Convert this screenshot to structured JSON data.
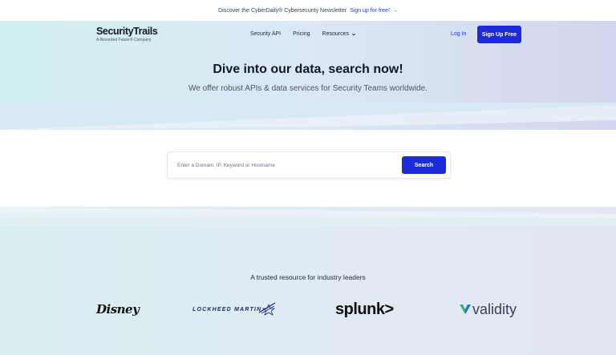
{
  "announcement": {
    "text": "Discover the CyberDaily® Cybersecurity Newsletter",
    "link": "Sign up for free!",
    "arrow": "→"
  },
  "nav": {
    "logo": "SecurityTrails",
    "logo_sub": "A Recorded Future® Company",
    "links": [
      "Security API",
      "Pricing",
      "Resources"
    ],
    "login": "Log In",
    "signup": "Sign Up Free"
  },
  "hero": {
    "title": "Dive into our data, search now!",
    "subtitle": "We offer robust APIs & data services for Security Teams worldwide."
  },
  "search": {
    "placeholder": "Enter a Domain, IP, Keyword or Hostname",
    "button": "Search"
  },
  "trusted": {
    "heading": "A trusted resource for industry leaders",
    "brands": [
      "Disney",
      "LOCKHEED MARTIN",
      "splunk>",
      "validity"
    ]
  },
  "colors": {
    "accent": "#1b2bd9",
    "link": "#1f3fd6",
    "validity_green": "#2bb673",
    "validity_blue": "#1d6fd6"
  }
}
